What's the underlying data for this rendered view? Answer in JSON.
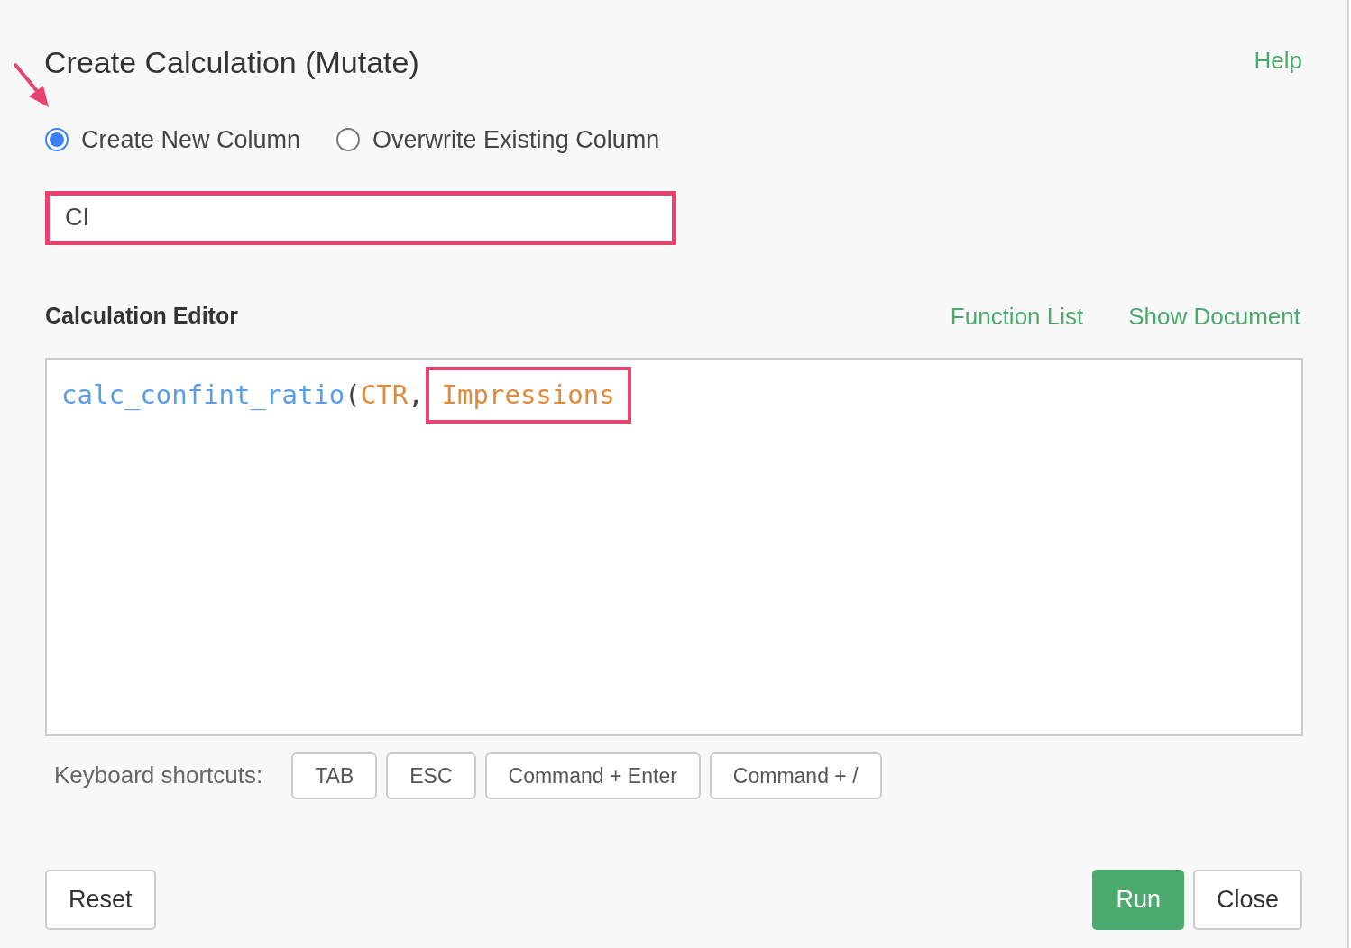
{
  "dialog": {
    "title": "Create Calculation (Mutate)",
    "help_link": "Help"
  },
  "mode_options": [
    {
      "label": "Create New Column",
      "selected": true,
      "pointer_arrow": true
    },
    {
      "label": "Overwrite Existing Column",
      "selected": false,
      "pointer_arrow": false
    }
  ],
  "column_name_field": {
    "value": "CI",
    "highlighted": true
  },
  "editor": {
    "title": "Calculation Editor",
    "links": [
      "Function List",
      "Show Document"
    ],
    "code_tokens": [
      {
        "text": "calc_confint_ratio",
        "kind": "function",
        "highlighted": false
      },
      {
        "text": "(",
        "kind": "punct",
        "highlighted": false
      },
      {
        "text": "CTR",
        "kind": "column",
        "highlighted": false
      },
      {
        "text": ",",
        "kind": "punct",
        "highlighted": false
      },
      {
        "text": "Impressions",
        "kind": "column",
        "highlighted": true
      }
    ]
  },
  "shortcuts": {
    "label": "Keyboard shortcuts:",
    "keys": [
      "TAB",
      "ESC",
      "Command + Enter",
      "Command + /"
    ]
  },
  "buttons": [
    {
      "label": "Reset",
      "kind": "default"
    },
    {
      "label": "Run",
      "kind": "primary"
    },
    {
      "label": "Close",
      "kind": "default"
    }
  ]
}
